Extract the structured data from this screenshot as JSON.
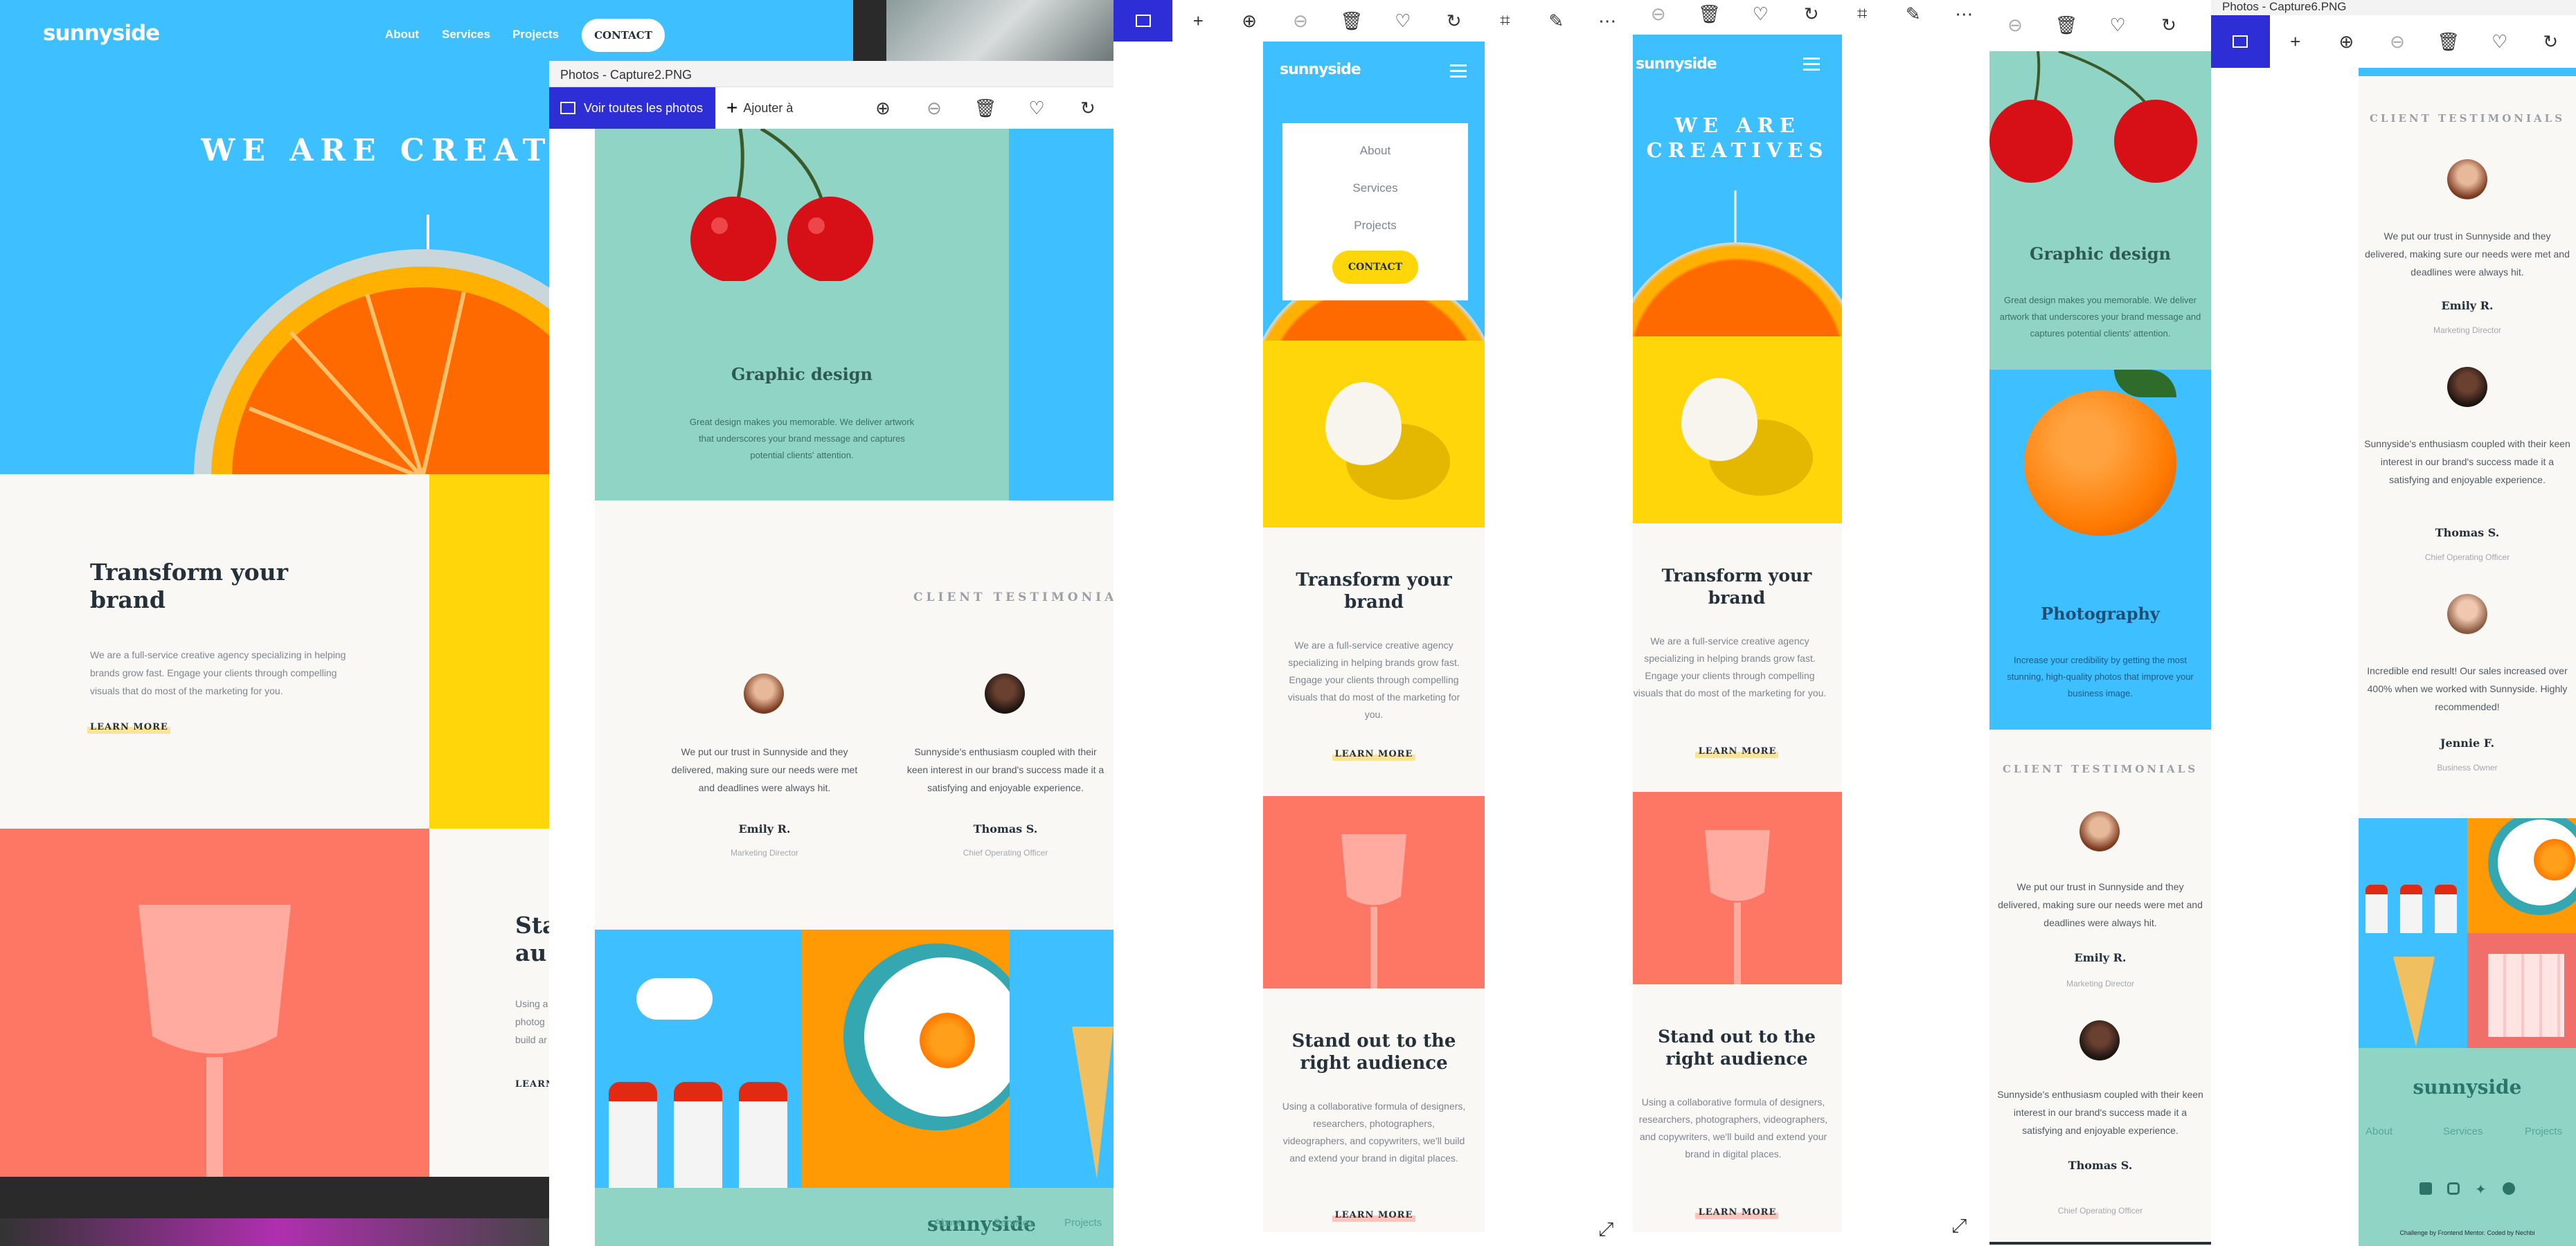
{
  "brand": "sunnyside",
  "nav": {
    "about": "About",
    "services": "Services",
    "projects": "Projects",
    "contact": "CONTACT"
  },
  "hero": {
    "title_wide": "WE ARE CREAT",
    "title_line1": "WE ARE",
    "title_line2": "CREATIVES"
  },
  "transform": {
    "title": "Transform your brand",
    "body": "We are a full-service creative agency specializing in helping brands grow fast. Engage your clients through compelling visuals that do most of the marketing for you.",
    "link": "LEARN MORE"
  },
  "standout": {
    "title": "Stand out to the right audience",
    "title_crop": "Sta\nau",
    "body": "Using a collaborative formula of designers, researchers, photographers, videographers, and copywriters, we'll build and extend your brand in digital places.",
    "body_crop": "Using a\nphotog\nbuild ar",
    "link": "LEARN MORE",
    "link_crop": "LEARN"
  },
  "graphic": {
    "title": "Graphic design",
    "body": "Great design makes you memorable. We deliver artwork that underscores your brand message and captures potential clients' attention."
  },
  "photography": {
    "title": "Photography",
    "body": "Increase your credibility by getting the most stunning, high-quality photos that improve your business image."
  },
  "testimonials": {
    "heading": "CLIENT TESTIMONIALS",
    "items": [
      {
        "quote": "We put our trust in Sunnyside and they delivered, making sure our needs were met and deadlines were always hit.",
        "name": "Emily R.",
        "role": "Marketing Director"
      },
      {
        "quote": "Sunnyside's enthusiasm coupled with their keen interest in our brand's success made it a satisfying and enjoyable experience.",
        "name": "Thomas S.",
        "role": "Chief Operating Officer"
      },
      {
        "quote": "Incredible end result! Our sales increased over 400% when we worked with Sunnyside. Highly recommended!",
        "name": "Jennie F.",
        "role": "Business Owner"
      }
    ]
  },
  "footer": {
    "brand": "sunnyside",
    "about": "About",
    "services": "Services",
    "projects": "Projects",
    "credit": "Challenge by Frontend Mentor. Coded by Nechbi"
  },
  "photos_app": {
    "title2": "Photos - Capture2.PNG",
    "title6": "Photos - Capture6.PNG",
    "see_all": "Voir toutes les photos",
    "add": "Ajouter à"
  },
  "colors": {
    "blue": "#3ebfff",
    "yellow": "#ffd60a",
    "coral": "#fe7664",
    "teal": "#90d4c5",
    "cream": "#faf8f5",
    "photos_accent": "#2e2ed6",
    "dark": "#24303a"
  }
}
